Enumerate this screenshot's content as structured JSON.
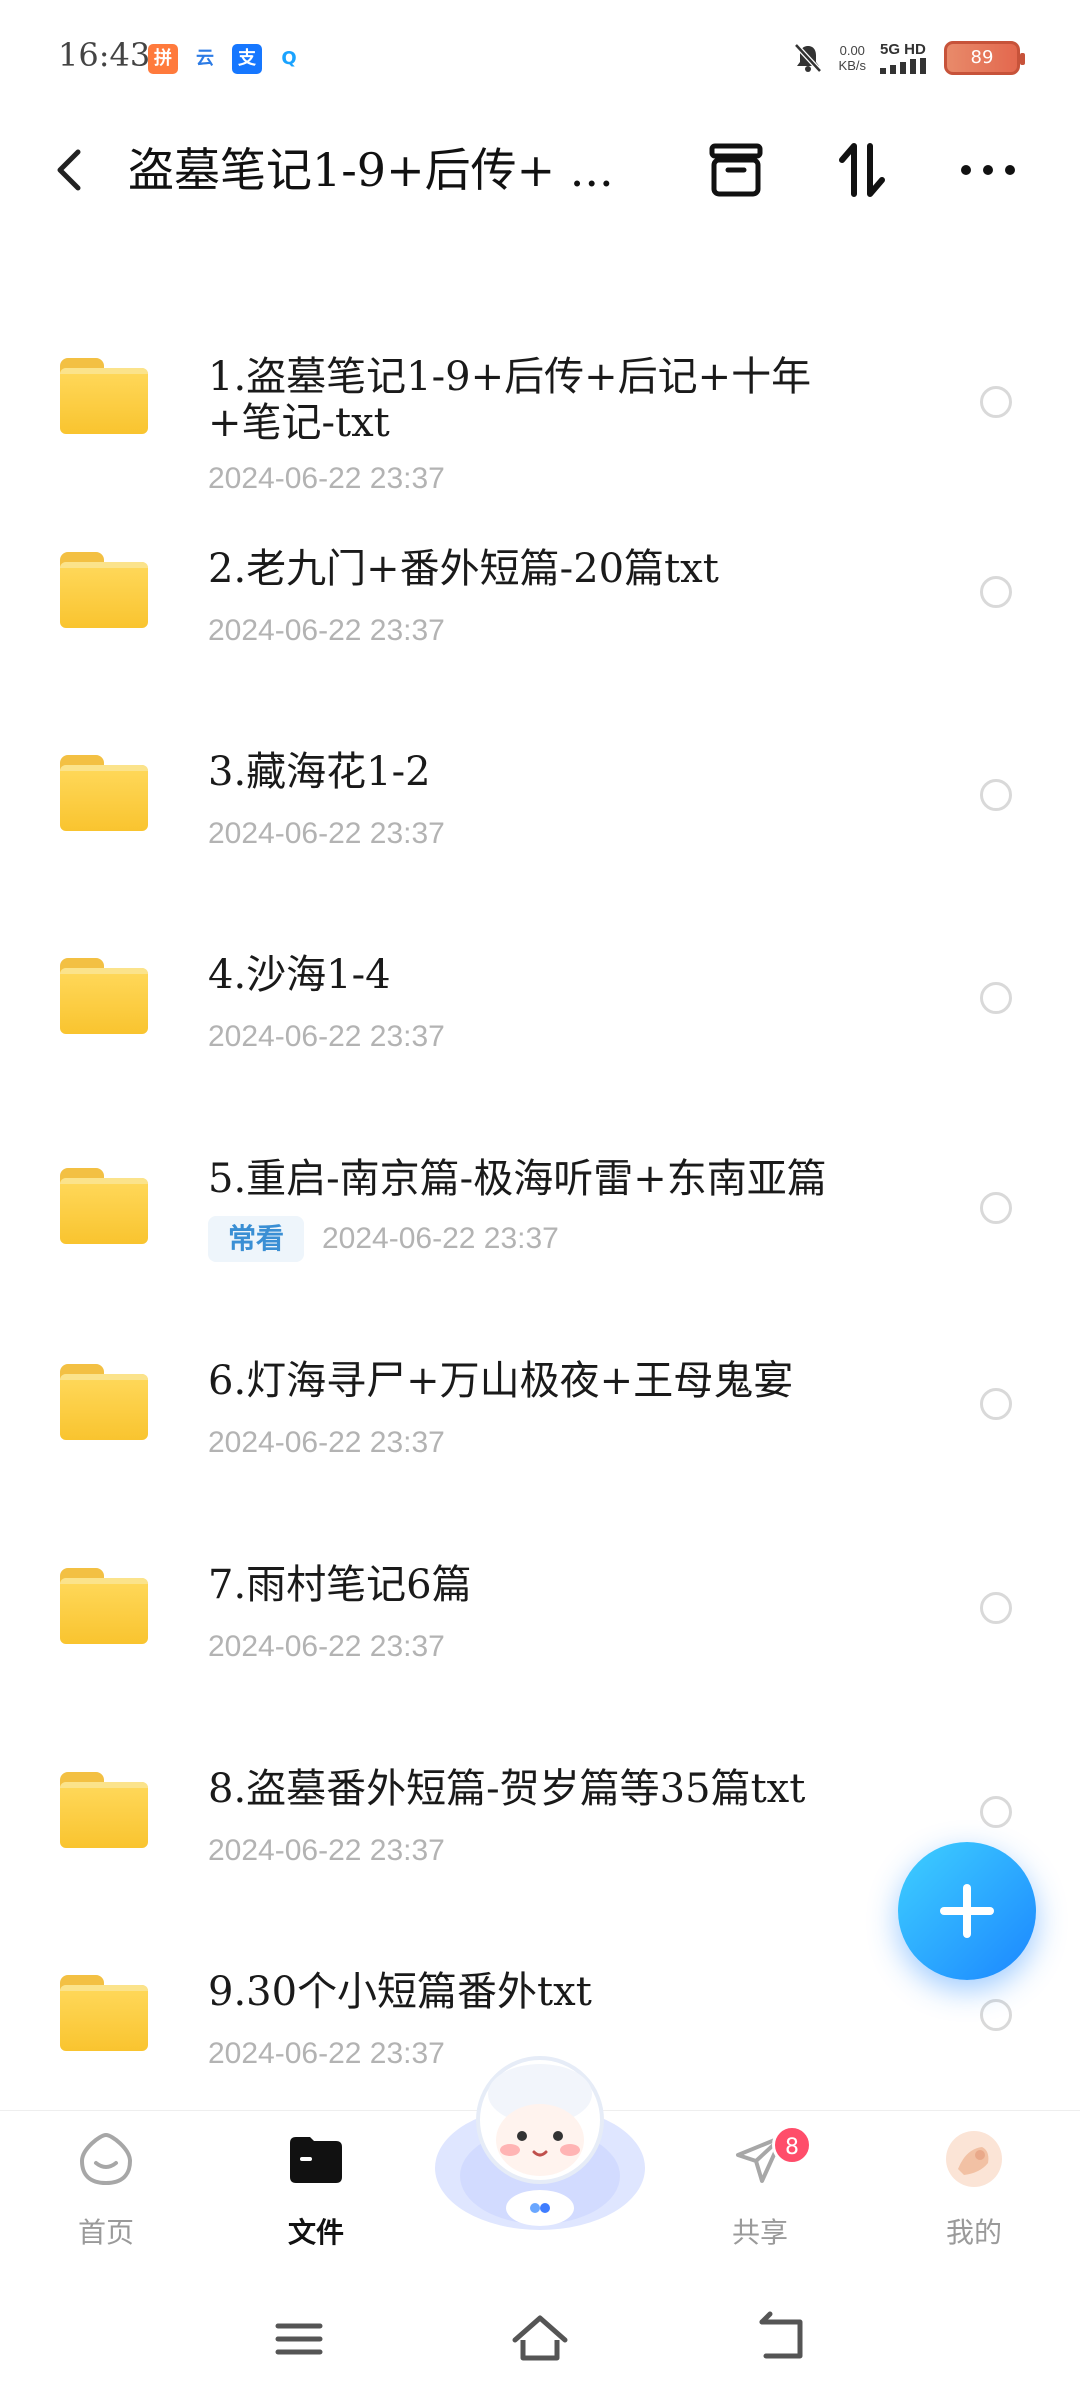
{
  "status": {
    "time": "16:43",
    "apps": [
      "拼",
      "云",
      "支",
      "Q"
    ],
    "net_speed_value": "0.00",
    "net_speed_unit": "KB/s",
    "network": "5G HD",
    "battery": "89"
  },
  "header": {
    "title": "盗墓笔记1-9+后传+ ...",
    "icons": [
      "back-icon",
      "archive-icon",
      "sort-icon",
      "more-icon"
    ]
  },
  "files": [
    {
      "name": "1.盗墓笔记1-9+后传+后记+十年+笔记-txt",
      "date": "2024-06-22  23:37"
    },
    {
      "name": "2.老九门+番外短篇-20篇txt",
      "date": "2024-06-22  23:37"
    },
    {
      "name": "3.藏海花1-2",
      "date": "2024-06-22  23:37"
    },
    {
      "name": "4.沙海1-4",
      "date": "2024-06-22  23:37"
    },
    {
      "name": "5.重启-南京篇-极海听雷+东南亚篇",
      "date": "2024-06-22  23:37",
      "tag": "常看"
    },
    {
      "name": "6.灯海寻尸+万山极夜+王母鬼宴",
      "date": "2024-06-22  23:37"
    },
    {
      "name": "7.雨村笔记6篇",
      "date": "2024-06-22  23:37"
    },
    {
      "name": "8.盗墓番外短篇-贺岁篇等35篇txt",
      "date": "2024-06-22  23:37"
    },
    {
      "name": "9.30个小短篇番外txt",
      "date": "2024-06-22  23:37"
    }
  ],
  "nav": {
    "home": "首页",
    "files": "文件",
    "share": "共享",
    "share_badge": "8",
    "mine": "我的"
  },
  "colors": {
    "accent": "#1b86ff",
    "folder": "#f9c42f",
    "badge": "#ff4d6a"
  }
}
